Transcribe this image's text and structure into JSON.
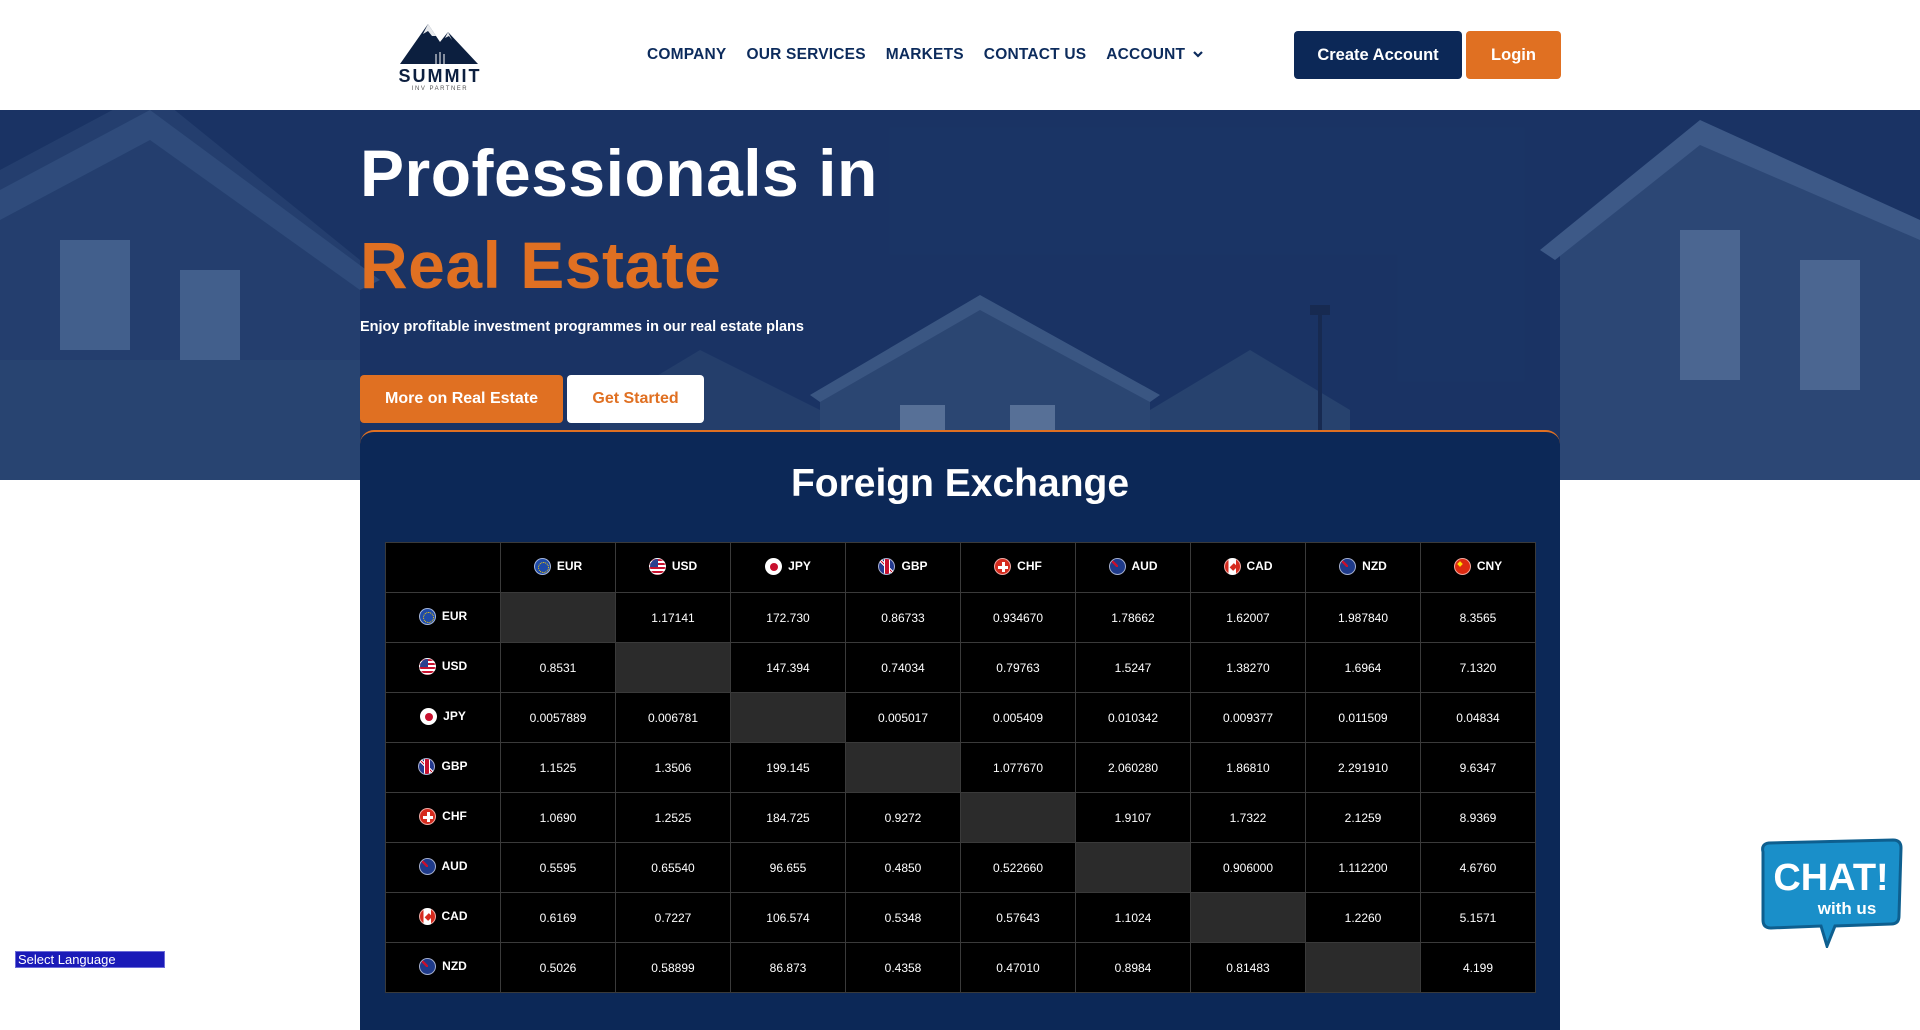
{
  "brand": {
    "name": "SUMMIT",
    "tagline": "INV PARTNER",
    "colors": {
      "navy": "#0c2857",
      "orange": "#e07022"
    }
  },
  "nav": {
    "items": [
      "COMPANY",
      "OUR SERVICES",
      "MARKETS",
      "CONTACT US",
      "ACCOUNT"
    ],
    "account_icon": "chevron-down-icon"
  },
  "header_buttons": {
    "create": "Create Account",
    "login": "Login"
  },
  "hero": {
    "title_line1": "Professionals in",
    "title_line2": "Real Estate",
    "subtitle": "Enjoy profitable investment programmes in our real estate plans",
    "btn_more": "More on Real Estate",
    "btn_start": "Get Started"
  },
  "fx": {
    "title": "Foreign Exchange",
    "currencies": [
      "EUR",
      "USD",
      "JPY",
      "GBP",
      "CHF",
      "AUD",
      "CAD",
      "NZD",
      "CNY"
    ],
    "rows": [
      {
        "code": "EUR",
        "values": [
          "",
          "1.17141",
          "172.730",
          "0.86733",
          "0.934670",
          "1.78662",
          "1.62007",
          "1.987840",
          "8.3565"
        ]
      },
      {
        "code": "USD",
        "values": [
          "0.8531",
          "",
          "147.394",
          "0.74034",
          "0.79763",
          "1.5247",
          "1.38270",
          "1.6964",
          "7.1320"
        ]
      },
      {
        "code": "JPY",
        "values": [
          "0.0057889",
          "0.006781",
          "",
          "0.005017",
          "0.005409",
          "0.010342",
          "0.009377",
          "0.011509",
          "0.04834"
        ]
      },
      {
        "code": "GBP",
        "values": [
          "1.1525",
          "1.3506",
          "199.145",
          "",
          "1.077670",
          "2.060280",
          "1.86810",
          "2.291910",
          "9.6347"
        ]
      },
      {
        "code": "CHF",
        "values": [
          "1.0690",
          "1.2525",
          "184.725",
          "0.9272",
          "",
          "1.9107",
          "1.7322",
          "2.1259",
          "8.9369"
        ]
      },
      {
        "code": "AUD",
        "values": [
          "0.5595",
          "0.65540",
          "96.655",
          "0.4850",
          "0.522660",
          "",
          "0.906000",
          "1.112200",
          "4.6760"
        ]
      },
      {
        "code": "CAD",
        "values": [
          "0.6169",
          "0.7227",
          "106.574",
          "0.5348",
          "0.57643",
          "1.1024",
          "",
          "1.2260",
          "5.1571"
        ]
      },
      {
        "code": "NZD",
        "values": [
          "0.5026",
          "0.58899",
          "86.873",
          "0.4358",
          "0.47010",
          "0.8984",
          "0.81483",
          "",
          "4.199"
        ]
      }
    ]
  },
  "language_select": {
    "label": "Select Language"
  },
  "chat_widget": {
    "line1": "CHAT!",
    "line2": "with us"
  }
}
